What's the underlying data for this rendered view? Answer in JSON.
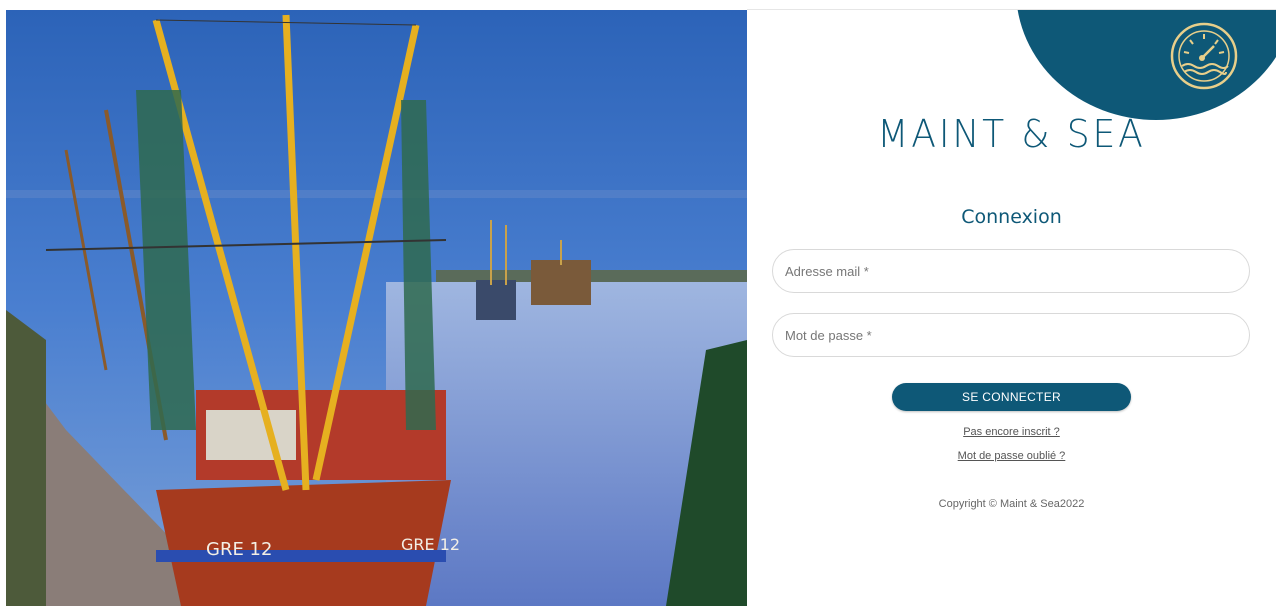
{
  "brand": {
    "name": "MAINT & SEA",
    "accent_color": "#0e5877",
    "logo_icon": "gauge-waves-icon"
  },
  "login": {
    "title": "Connexion",
    "email": {
      "placeholder": "Adresse mail *",
      "value": ""
    },
    "password": {
      "placeholder": "Mot de passe *",
      "value": ""
    },
    "submit_label": "SE CONNECTER",
    "signup_link": "Pas encore inscrit ?",
    "forgot_link": "Mot de passe oublié ?"
  },
  "footer": {
    "copyright": "Copyright © Maint & Sea2022"
  },
  "background_image": {
    "subject": "fishing-boats-harbor-photo",
    "boat_labels": [
      "GRE 12",
      "GRE 12"
    ]
  }
}
